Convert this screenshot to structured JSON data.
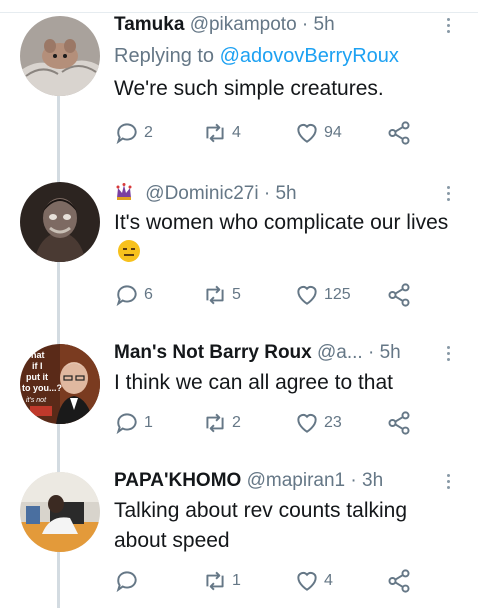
{
  "tweets": [
    {
      "name": "Tamuka",
      "handle": "@pikampoto",
      "separator": "·",
      "time": "5h",
      "reply_prefix": "Replying to",
      "reply_to": "@adovovBerryRoux",
      "text": "We're such simple creatures.",
      "replies": "2",
      "retweets": "4",
      "likes": "94"
    },
    {
      "name": "",
      "badge_icon": "jester-icon",
      "handle": "@Dominic27i",
      "separator": "·",
      "time": "5h",
      "text": "It's women who complicate our lives",
      "emoji": "expressionless-face-emoji",
      "replies": "6",
      "retweets": "5",
      "likes": "125"
    },
    {
      "name": "Man's Not Barry Roux",
      "handle": "@a...",
      "separator": "·",
      "time": "5h",
      "text": "I think we can all agree to that",
      "replies": "1",
      "retweets": "2",
      "likes": "23"
    },
    {
      "name": "PAPA'KHOMO",
      "handle": "@mapiran1",
      "separator": "·",
      "time": "3h",
      "text": "Talking about rev counts talking about speed",
      "replies": "",
      "retweets": "1",
      "likes": "4"
    }
  ],
  "avatar_texts": {
    "barry": [
      "what",
      "if I",
      "put it",
      "to you...?",
      "it's not"
    ]
  },
  "colors": {
    "accent": "#1da1f2",
    "muted": "#657786",
    "text": "#14171a"
  }
}
